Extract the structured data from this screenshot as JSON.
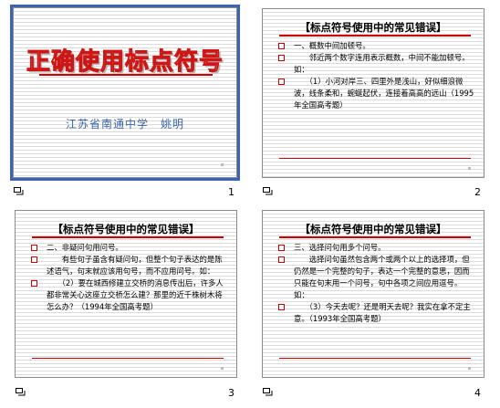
{
  "slides": [
    {
      "number": "1",
      "title": "正确使用标点符号",
      "author": "江苏省南通中学　姚明"
    },
    {
      "number": "2",
      "heading": "【标点符号使用中的常见错误】",
      "bullets": [
        "一、概数中间加顿号。",
        "　　邻近两个数字连用表示概数，中间不能加顿号。如：",
        "　　（1）小河对岸三、四里外是浅山，好似细浪微波，线条柔和，蜿蜒起伏，连接着高高的远山（1995年全国高考题）"
      ]
    },
    {
      "number": "3",
      "heading": "【标点符号使用中的常见错误】",
      "bullets": [
        "二、非疑问句用问号。",
        "　　有些句子虽含有疑问句，但整个句子表达的是陈述语气，句末就应该用句号，而不应用问号。如：",
        "　　（2）要在城西修建立交桥的消息传出后，许多人都非常关心这座立交桥怎么建？那里的近千株树木将怎么办？（1994年全国高考题）"
      ]
    },
    {
      "number": "4",
      "heading": "【标点符号使用中的常见错误】",
      "bullets": [
        "三、选择问句用多个问号。",
        "　　选择问句虽然包含两个或两个以上的选择项，但仍然是一个完整的句子，表达一个完整的意思，因而只能在句末用一个问号，句中各项之间应用逗号。如：",
        "　　（3）今天去呢？还是明天去呢？我实在拿不定主意。（1993年全国高考题）"
      ]
    }
  ]
}
